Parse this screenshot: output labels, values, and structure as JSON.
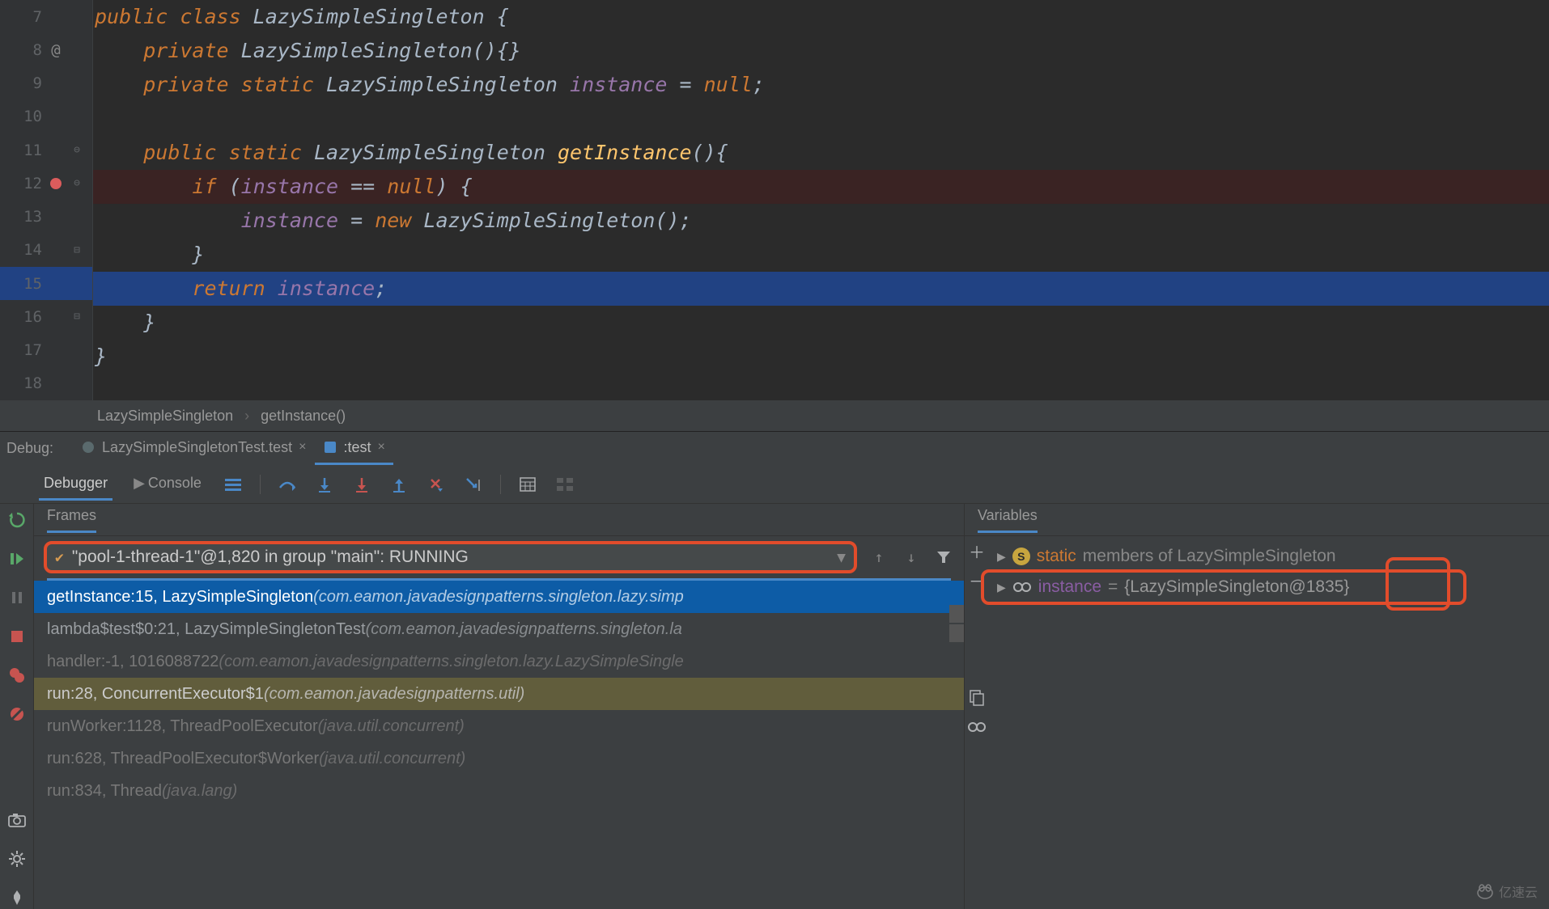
{
  "gutter": {
    "lines": [
      "7",
      "8",
      "9",
      "10",
      "11",
      "12",
      "13",
      "14",
      "15",
      "16",
      "17",
      "18"
    ]
  },
  "code": {
    "l7": {
      "pre": "",
      "k1": "public class ",
      "c1": "LazySimpleSingleton ",
      "p1": "{"
    },
    "l8": {
      "pre": "    ",
      "k1": "private ",
      "c1": "LazySimpleSingleton",
      "p1": "(){}"
    },
    "l9": {
      "pre": "    ",
      "k1": "private static ",
      "c1": "LazySimpleSingleton ",
      "f1": "instance ",
      "p1": "= ",
      "k2": "null",
      "p2": ";"
    },
    "l10": {
      "pre": ""
    },
    "l11": {
      "pre": "    ",
      "k1": "public static ",
      "c1": "LazySimpleSingleton ",
      "m1": "getInstance",
      "p1": "(){"
    },
    "l12": {
      "pre": "        ",
      "k1": "if ",
      "p1": "(",
      "f1": "instance ",
      "p2": "== ",
      "k2": "null",
      "p3": ") {"
    },
    "l13": {
      "pre": "            ",
      "f1": "instance ",
      "p1": "= ",
      "k1": "new ",
      "c1": "LazySimpleSingleton",
      "p2": "();"
    },
    "l14": {
      "pre": "        ",
      "p1": "}"
    },
    "l15": {
      "pre": "        ",
      "k1": "return ",
      "f1": "instance",
      "p1": ";"
    },
    "l16": {
      "pre": "    ",
      "p1": "}"
    },
    "l17": {
      "pre": "",
      "p1": "}"
    },
    "l18": {
      "pre": ""
    }
  },
  "breadcrumb": {
    "a": "LazySimpleSingleton",
    "sep": "›",
    "b": "getInstance()"
  },
  "debugHeader": {
    "label": "Debug:",
    "tab1": "LazySimpleSingletonTest.test",
    "tab2": ":test"
  },
  "debuggerTabs": {
    "debugger": "Debugger",
    "console": "Console"
  },
  "frames": {
    "title": "Frames",
    "thread": "\"pool-1-thread-1\"@1,820 in group \"main\": RUNNING",
    "stack": [
      {
        "sig": "getInstance:15, LazySimpleSingleton ",
        "pkg": "(com.eamon.javadesignpatterns.singleton.lazy.simp",
        "cls": "selected"
      },
      {
        "sig": "lambda$test$0:21, LazySimpleSingletonTest ",
        "pkg": "(com.eamon.javadesignpatterns.singleton.la",
        "cls": ""
      },
      {
        "sig": "handler:-1, 1016088722 ",
        "pkg": "(com.eamon.javadesignpatterns.singleton.lazy.LazySimpleSingle",
        "cls": "lib"
      },
      {
        "sig": "run:28, ConcurrentExecutor$1 ",
        "pkg": "(com.eamon.javadesignpatterns.util)",
        "cls": "yellow"
      },
      {
        "sig": "runWorker:1128, ThreadPoolExecutor ",
        "pkg": "(java.util.concurrent)",
        "cls": "lib"
      },
      {
        "sig": "run:628, ThreadPoolExecutor$Worker ",
        "pkg": "(java.util.concurrent)",
        "cls": "lib"
      },
      {
        "sig": "run:834, Thread ",
        "pkg": "(java.lang)",
        "cls": "lib"
      }
    ]
  },
  "variables": {
    "title": "Variables",
    "staticLabelKw": "static",
    "staticLabelRest": " members of LazySimpleSingleton",
    "instanceName": "instance",
    "instanceEq": " = ",
    "instanceVal": "{LazySimpleSingleton@1835}"
  },
  "watermark": "亿速云"
}
